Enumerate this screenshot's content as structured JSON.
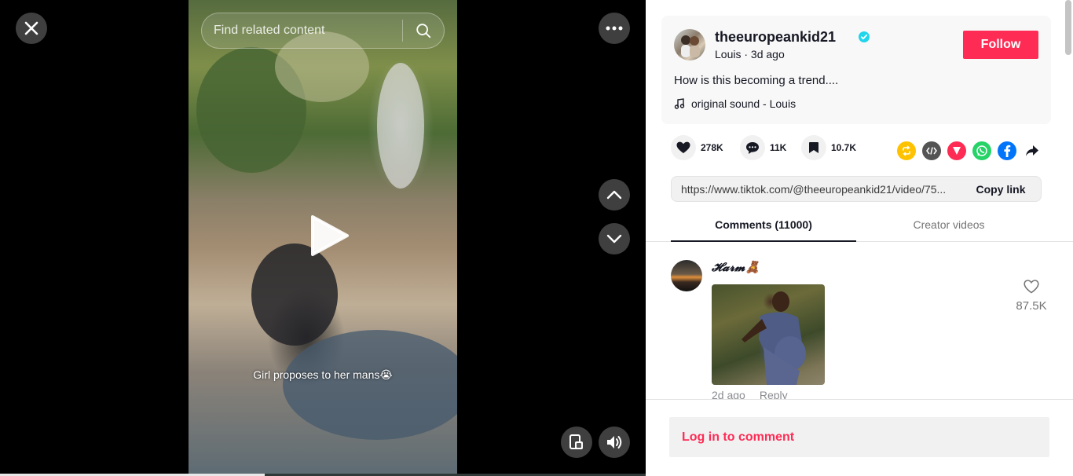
{
  "search": {
    "placeholder": "Find related content"
  },
  "video": {
    "caption": "Girl proposes to her mans😭",
    "progress_percent": 41
  },
  "author": {
    "username": "theeuropeankid21",
    "nickname": "Louis",
    "separator": " · ",
    "posted": "3d ago",
    "follow_label": "Follow"
  },
  "post": {
    "description": "How is this becoming a trend....",
    "music": "original sound - Louis"
  },
  "stats": {
    "likes": "278K",
    "comments": "11K",
    "saves": "10.7K"
  },
  "share_icons": [
    "repost-icon",
    "embed-icon",
    "send-icon",
    "whatsapp-icon",
    "facebook-icon",
    "share-arrow-icon"
  ],
  "link": {
    "url": "https://www.tiktok.com/@theeuropeankid21/video/75...",
    "copy_label": "Copy link"
  },
  "tabs": {
    "comments": "Comments (11000)",
    "creator": "Creator videos"
  },
  "comment": {
    "username": "𝓗𝓪𝓻𝓶🧸",
    "time": "2d ago",
    "reply_label": "Reply",
    "likes": "87.5K"
  },
  "footer": {
    "login_label": "Log in to comment"
  },
  "colors": {
    "brand": "#fe2c55",
    "verified": "#20d5ec",
    "text_primary": "#161823",
    "text_secondary": "#757575"
  }
}
